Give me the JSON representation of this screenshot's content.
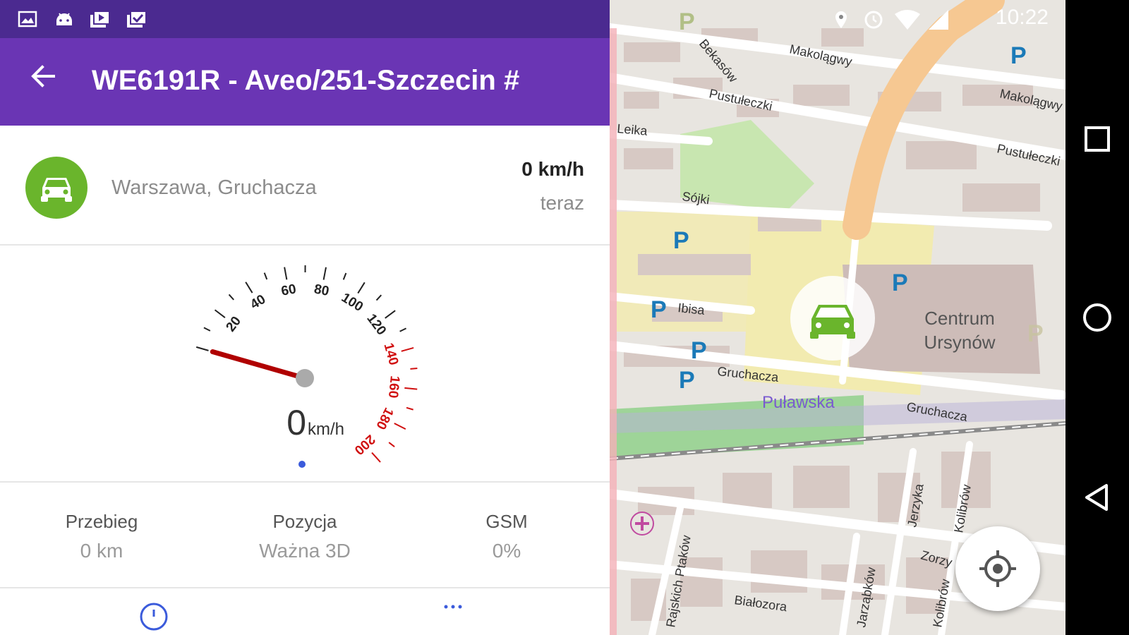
{
  "status_bar": {
    "left_icons": [
      "image-icon",
      "android-icon",
      "photo-library-icon",
      "check-library-icon"
    ],
    "right_icons": [
      "location-icon",
      "alarm-icon",
      "wifi-icon",
      "signal-icon"
    ],
    "time": "10:22"
  },
  "app_bar": {
    "back_icon": "arrow-back-icon",
    "title": "WE6191R - Aveo/251-Szczecin #"
  },
  "vehicle": {
    "icon": "car-icon",
    "address": "Warszawa, Gruchacza",
    "speed": "0 km/h",
    "time": "teraz"
  },
  "gauge": {
    "value": 0,
    "max": 200,
    "unit": "km/h",
    "ticks": [
      "20",
      "40",
      "60",
      "80",
      "100",
      "120",
      "140",
      "160",
      "180",
      "200"
    ],
    "red_from": 140,
    "colors": {
      "normal": "#222222",
      "red": "#d01010",
      "needle": "#b00000"
    }
  },
  "pager": {
    "pages": 1,
    "active": 0
  },
  "stats": [
    {
      "label": "Przebieg",
      "value": "0 km"
    },
    {
      "label": "Pozycja",
      "value": "Ważna 3D"
    },
    {
      "label": "GSM",
      "value": "0%"
    }
  ],
  "bottom_icons": [
    "history-icon",
    "more-icon"
  ],
  "map": {
    "streets": [
      "Makolągwy",
      "Bekasów",
      "Pustułeczki",
      "Leika",
      "Sójki",
      "Ibisa",
      "Gruchacza",
      "Puławska",
      "Gruchacza",
      "Jerzyka",
      "Kolibrów",
      "Zorzy",
      "Białozora",
      "Jarząbków",
      "Rajskich Ptaków",
      "Makolągwy",
      "Pustułeczki",
      "Kolibrów"
    ],
    "poi": {
      "title_line1": "Centrum",
      "title_line2": "Ursynów"
    },
    "parking_label": "P",
    "car_marker_icon": "car-icon",
    "locate_icon": "my-location-icon",
    "colors": {
      "green": "#a8d8a0",
      "yellow": "#f0e9a6",
      "road_orange": "#f6c892",
      "building": "#d7c9c4"
    }
  },
  "nav_bar": {
    "icons": [
      "recent-apps-icon",
      "home-icon",
      "back-icon"
    ]
  },
  "colors": {
    "primary": "#6a35b4",
    "primary_dark": "#4b2a90",
    "accent_green": "#6ab52c",
    "page_dot": "#3b5bdb"
  }
}
